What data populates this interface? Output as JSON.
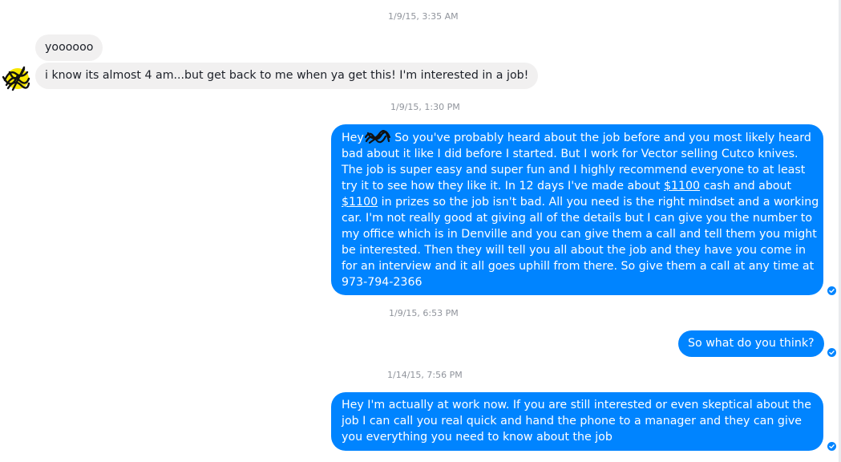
{
  "conversation": {
    "timestamps": [
      "1/9/15, 3:35 AM",
      "1/9/15, 1:30 PM",
      "1/9/15, 6:53 PM",
      "1/14/15, 7:56 PM"
    ],
    "incoming": [
      "yoooooo",
      "i know its almost 4 am...but get back to me when ya get this! I'm interested in a job!"
    ],
    "outgoing_long": {
      "greeting": "Hey",
      "line1_rest": " So you've probably heard about the job before and you most likely heard",
      "line2": "bad about it like I did before I started. But I work for Vector selling Cutco knives.",
      "line3": "The job is super easy and super fun and I highly recommend everyone to at least",
      "line4_pre": "try it to see how they like it. In 12 days I've made about ",
      "line4_link": "$1100",
      "line4_post": " cash and about",
      "line5_link": "$1100",
      "line5_post": " in prizes so the job isn't bad. All you need is the right mindset and a working",
      "line6": "car. I'm not really good at giving all of the details but I can give you the number to",
      "line7": "my office which is in Denville and you can give them a call and tell them you might",
      "line8": "be interested. Then they will tell you all about the job and they have you come in",
      "line9": "for an interview and it all goes uphill from there. So give them a call at any time at",
      "line10": "973-794-2366"
    },
    "outgoing_short": "So what do you think?",
    "outgoing_last": {
      "line1": "Hey I'm actually at work now. If you are still interested or even skeptical about the",
      "line2": "job I can call you real quick and hand the phone to a manager and they can give",
      "line3": "you everything you need to know about the job"
    }
  },
  "colors": {
    "outgoing_bubble": "#0084ff",
    "incoming_bubble": "#f1f0f0",
    "timestamp": "#90949c"
  },
  "icons": {
    "avatar": "avatar-scribble-icon",
    "read_receipt": "read-receipt-check-icon"
  }
}
